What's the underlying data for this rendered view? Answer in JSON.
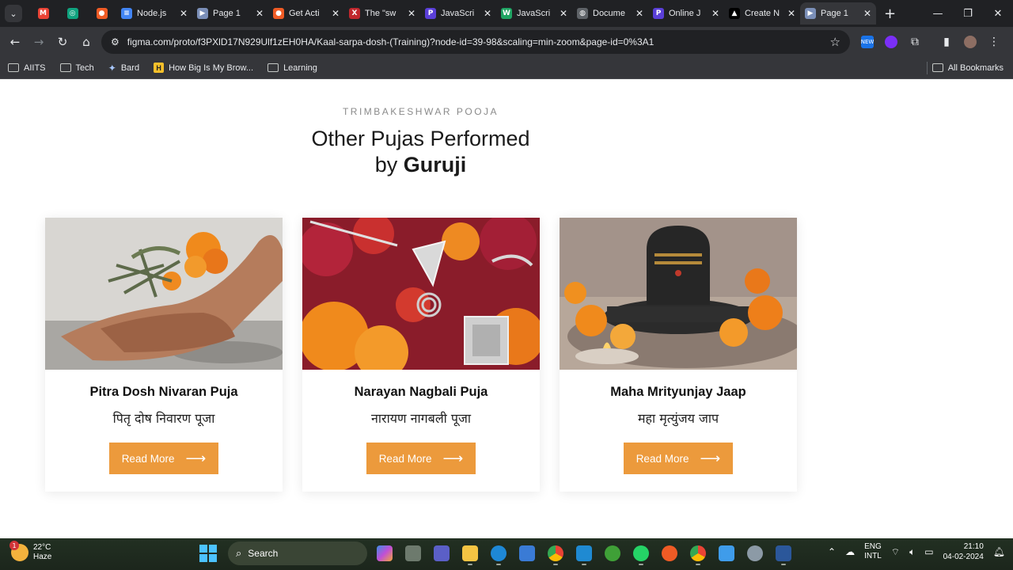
{
  "browser": {
    "tabs": [
      {
        "title": "",
        "icon": "gmail-icon",
        "color": "#ea4335",
        "glyph": "M"
      },
      {
        "title": "",
        "icon": "chatgpt-icon",
        "color": "#10a37f",
        "glyph": "◎"
      },
      {
        "title": "",
        "icon": "postman-icon",
        "color": "#ef5b25",
        "glyph": "●"
      },
      {
        "title": "Node.js",
        "icon": "docs-icon",
        "color": "#4285f4",
        "glyph": "≡"
      },
      {
        "title": "Page 1",
        "icon": "figma-icon",
        "color": "#7b8fb8",
        "glyph": "▶"
      },
      {
        "title": "Get Acti",
        "icon": "postman-icon",
        "color": "#ef5b25",
        "glyph": "●"
      },
      {
        "title": "The \"sw",
        "icon": "x-icon",
        "color": "#c1272d",
        "glyph": "X"
      },
      {
        "title": "JavaScri",
        "icon": "pluralsight-icon",
        "color": "#5a3fd8",
        "glyph": "P"
      },
      {
        "title": "JavaScri",
        "icon": "w-icon",
        "color": "#1fa463",
        "glyph": "W"
      },
      {
        "title": "Docume",
        "icon": "globe-icon",
        "color": "#5f6368",
        "glyph": "◍"
      },
      {
        "title": "Online J",
        "icon": "pluralsight-icon",
        "color": "#5a3fd8",
        "glyph": "P"
      },
      {
        "title": "Create N",
        "icon": "vercel-icon",
        "color": "#000000",
        "glyph": "▲"
      },
      {
        "title": "Page 1",
        "icon": "figma-icon",
        "color": "#7b8fb8",
        "glyph": "▶"
      }
    ],
    "url": "figma.com/proto/f3PXlD17N929Ulf1zEH0HA/Kaal-sarpa-dosh-(Training)?node-id=39-98&scaling=min-zoom&page-id=0%3A1",
    "bookmarks": [
      {
        "label": "AIITS",
        "icon": "folder-icon"
      },
      {
        "label": "Tech",
        "icon": "folder-icon"
      },
      {
        "label": "Bard",
        "icon": "sparkle-icon"
      },
      {
        "label": "How Big Is My Brow...",
        "icon": "h-icon"
      },
      {
        "label": "Learning",
        "icon": "folder-icon"
      }
    ],
    "all_bookmarks": "All Bookmarks"
  },
  "page": {
    "eyebrow": "TRIMBAKESHWAR POOJA",
    "heading_line1": "Other Pujas Performed",
    "heading_line2_prefix": "by ",
    "heading_line2_bold": "Guruji",
    "accent_color": "#ec9a3c",
    "cards": [
      {
        "title": "Pitra Dosh Nivaran Puja",
        "subtitle": "पितृ दोष निवारण पूजा",
        "button": "Read More"
      },
      {
        "title": "Narayan Nagbali Puja",
        "subtitle": "नारायण नागबली पूजा",
        "button": "Read More"
      },
      {
        "title": "Maha Mrityunjay Jaap",
        "subtitle": "महा मृत्युंजय जाप",
        "button": "Read More"
      }
    ]
  },
  "taskbar": {
    "weather_temp": "22°C",
    "weather_desc": "Haze",
    "weather_badge": "1",
    "search": "Search",
    "lang_line1": "ENG",
    "lang_line2": "INTL",
    "time": "21:10",
    "date": "04-02-2024"
  }
}
